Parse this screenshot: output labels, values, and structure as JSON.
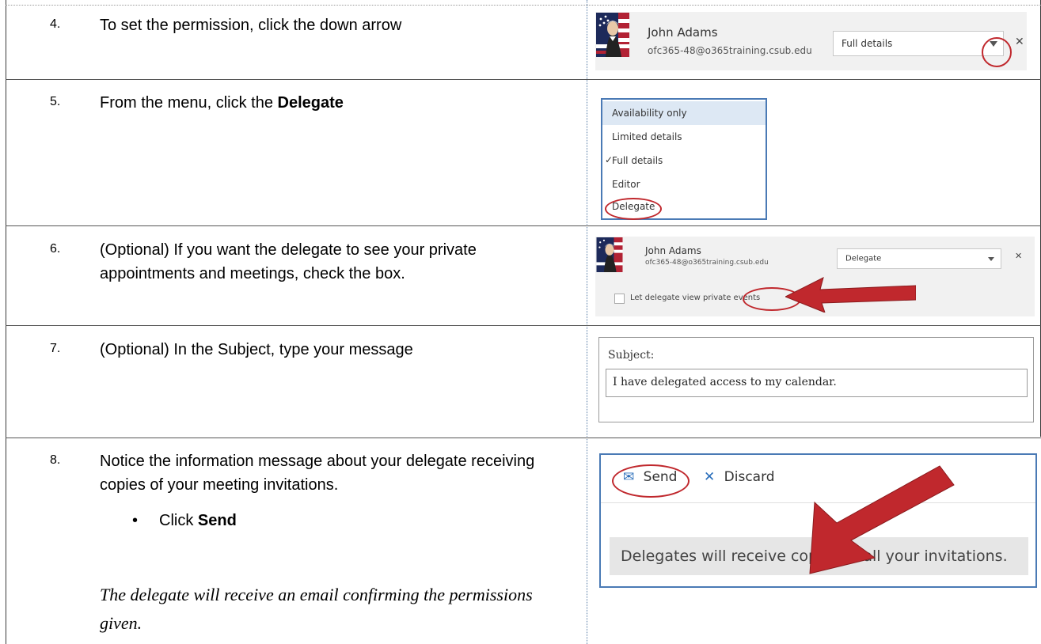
{
  "steps": [
    {
      "num": "4.",
      "text": "To set the permission, click the down arrow"
    },
    {
      "num": "5.",
      "text_pre": "From the menu, click the ",
      "text_bold": "Delegate"
    },
    {
      "num": "6.",
      "text": "(Optional) If you want the delegate to see your private appointments and meetings, check the box."
    },
    {
      "num": "7.",
      "text": "(Optional) In the Subject, type your message"
    },
    {
      "num": "8.",
      "text": "Notice the information message about your delegate receiving copies of your meeting invitations.",
      "bullet_pre": "Click ",
      "bullet_bold": "Send",
      "note": "The delegate will receive an email confirming the permissions given."
    }
  ],
  "user": {
    "name": "John Adams",
    "email": "ofc365-48@o365training.csub.edu"
  },
  "panel4": {
    "permission": "Full details"
  },
  "menu": {
    "items": [
      "Availability only",
      "Limited details",
      "Full details",
      "Editor",
      "Delegate"
    ],
    "selected_index": 2,
    "highlighted_index": 0
  },
  "panel6": {
    "permission": "Delegate",
    "checkbox_label": "Let delegate view private events"
  },
  "panel7": {
    "subject_label": "Subject:",
    "subject_value": "I have delegated access to my calendar."
  },
  "panel8": {
    "send_label": "Send",
    "discard_label": "Discard",
    "info": "Delegates will receive copies of all your invitations."
  },
  "colors": {
    "accent_border": "#4a7ab5",
    "annotation_red": "#c0282d",
    "menu_highlight": "#dde8f4"
  }
}
